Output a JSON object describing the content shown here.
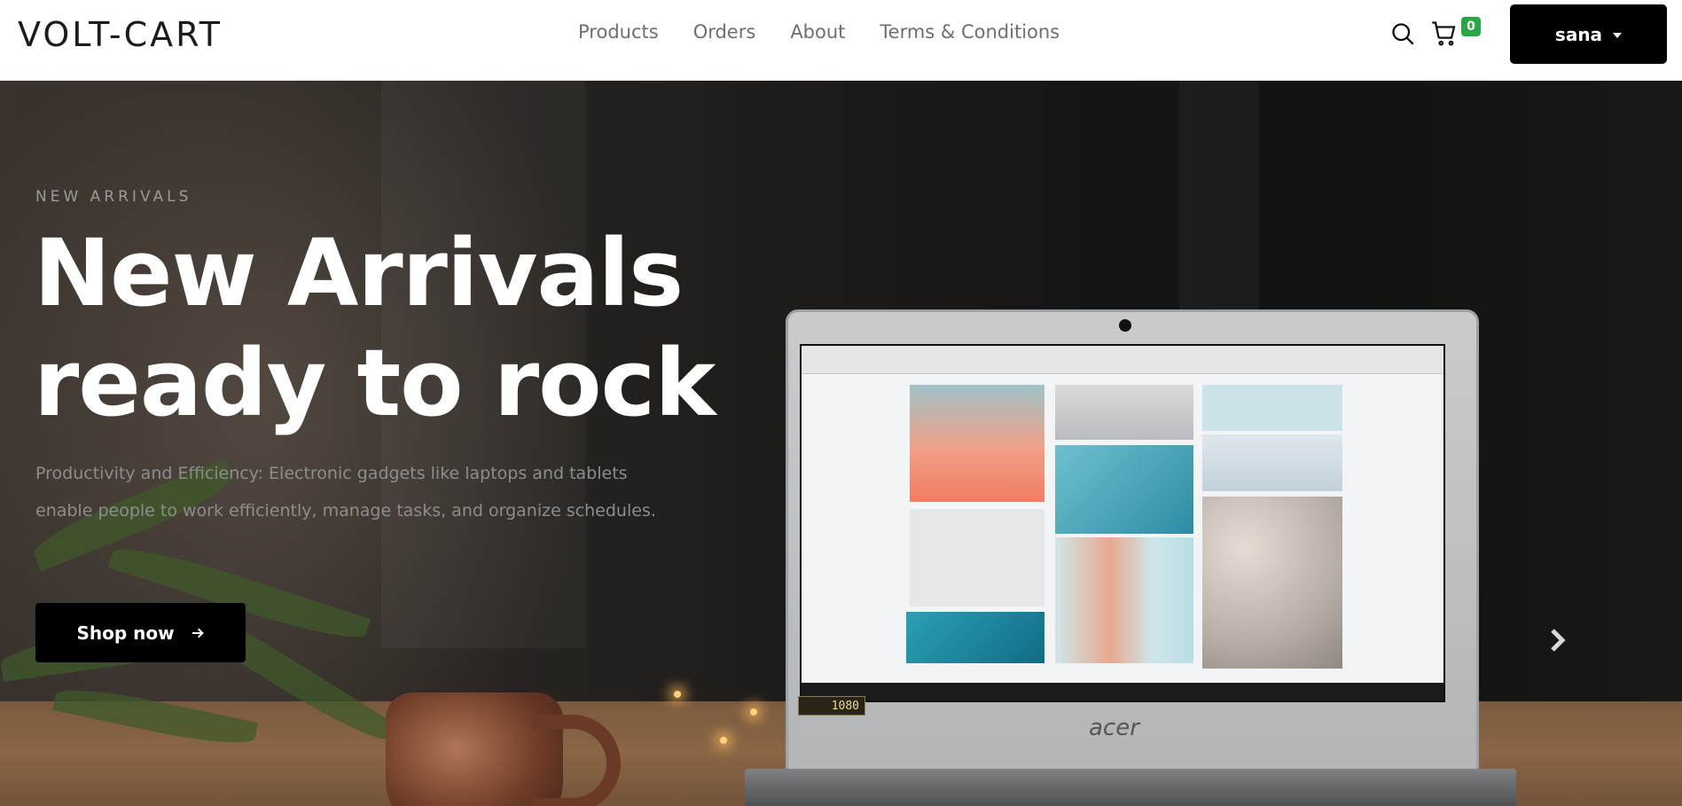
{
  "navbar": {
    "brand": "VOLT-CART",
    "links": [
      "Products",
      "Orders",
      "About",
      "Terms & Conditions"
    ],
    "icons": {
      "search": "search-icon",
      "cart": "cart-icon"
    },
    "cart_count": "0",
    "cart_badge_color": "#28a745",
    "user_label": "sana"
  },
  "hero": {
    "eyebrow": "NEW ARRIVALS",
    "title_line1": "New Arrivals",
    "title_line2": "ready to rock",
    "description": "Productivity and Efficiency: Electronic gadgets like laptops and tablets enable people to work efficiently, manage tasks, and organize schedules.",
    "cta_label": "Shop now",
    "cta_icon": "arrow-right-icon",
    "next_icon": "chevron-right-icon",
    "laptop_brand": "acer",
    "screen_badge": "1080"
  },
  "colors": {
    "button_bg": "#000000",
    "title": "#ffffff",
    "text_muted": "#8d8d8d"
  }
}
